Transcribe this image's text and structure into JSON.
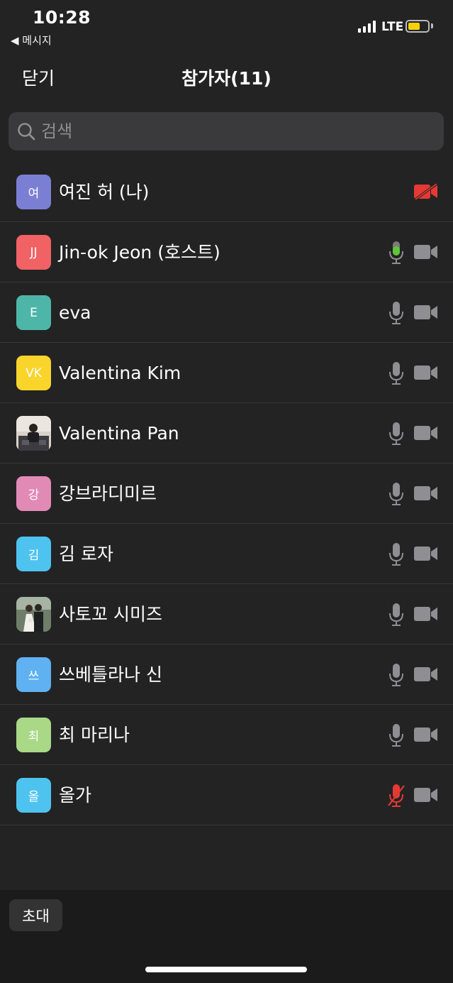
{
  "status": {
    "time": "10:28",
    "back_app": "◀ 메시지",
    "network": "LTE",
    "battery_color": "#f4d20b"
  },
  "nav": {
    "close_label": "닫기",
    "title": "참가자(11)"
  },
  "search": {
    "placeholder": "검색",
    "value": ""
  },
  "participants": [
    {
      "initials": "여",
      "name": "여진 허 (나)",
      "avatar_color": "#7b7fd4",
      "mic": "none",
      "video": "off"
    },
    {
      "initials": "JJ",
      "name": "Jin-ok Jeon (호스트)",
      "avatar_color": "#f16265",
      "mic": "speaking",
      "video": "on"
    },
    {
      "initials": "E",
      "name": "eva",
      "avatar_color": "#4db6a8",
      "mic": "on",
      "video": "on"
    },
    {
      "initials": "VK",
      "name": "Valentina Kim",
      "avatar_color": "#f9d42b",
      "mic": "on",
      "video": "on"
    },
    {
      "initials": "",
      "name": "Valentina Pan",
      "avatar_color": "#c9c3bd",
      "avatar_photo": "office-photo",
      "mic": "on",
      "video": "on"
    },
    {
      "initials": "강",
      "name": "강브라디미르",
      "avatar_color": "#e28ab6",
      "mic": "on",
      "video": "on"
    },
    {
      "initials": "김",
      "name": "김 로자",
      "avatar_color": "#4ec3f0",
      "mic": "on",
      "video": "on"
    },
    {
      "initials": "",
      "name": "사토꼬 시미즈",
      "avatar_color": "#8a9a8a",
      "avatar_photo": "wedding-photo",
      "mic": "on",
      "video": "on"
    },
    {
      "initials": "쓰",
      "name": "쓰베틀라나 신",
      "avatar_color": "#5fb1f2",
      "mic": "on",
      "video": "on"
    },
    {
      "initials": "최",
      "name": "최 마리나",
      "avatar_color": "#a9d887",
      "mic": "on",
      "video": "on"
    },
    {
      "initials": "올",
      "name": "올가",
      "avatar_color": "#4ec3f0",
      "mic": "muted",
      "video": "on"
    }
  ],
  "footer": {
    "invite_label": "초대"
  },
  "colors": {
    "background": "#232323",
    "mic_speaking": "#5ec638",
    "muted_red": "#e53935",
    "icon_gray": "#8e8e93"
  }
}
